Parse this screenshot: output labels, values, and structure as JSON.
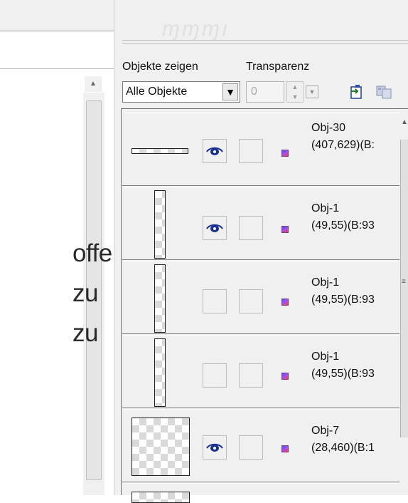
{
  "document_labels": [
    "offen",
    "zu",
    "zu"
  ],
  "panel": {
    "show_objects_label": "Objekte zeigen",
    "transparency_label": "Transparenz",
    "show_objects_value": "Alle Objekte",
    "transparency_value": "0"
  },
  "objects": [
    {
      "name": "Obj-30",
      "info": "(407,629)(B:",
      "visible": true
    },
    {
      "name": "Obj-1",
      "info": "(49,55)(B:93",
      "visible": true
    },
    {
      "name": "Obj-1",
      "info": "(49,55)(B:93",
      "visible": false
    },
    {
      "name": "Obj-1",
      "info": "(49,55)(B:93",
      "visible": false
    },
    {
      "name": "Obj-7",
      "info": "(28,460)(B:1",
      "visible": true
    }
  ],
  "icons": {
    "visibility": "eye-icon",
    "color": "color-swatch-icon",
    "import": "import-icon",
    "copy": "copy-icon",
    "dropdown": "chevron-down-icon"
  },
  "colors": {
    "panel_bg": "#f0f0f0",
    "eye": "#1b2f91",
    "swatch_from": "#2a64ff",
    "swatch_to": "#ff3a2a"
  }
}
